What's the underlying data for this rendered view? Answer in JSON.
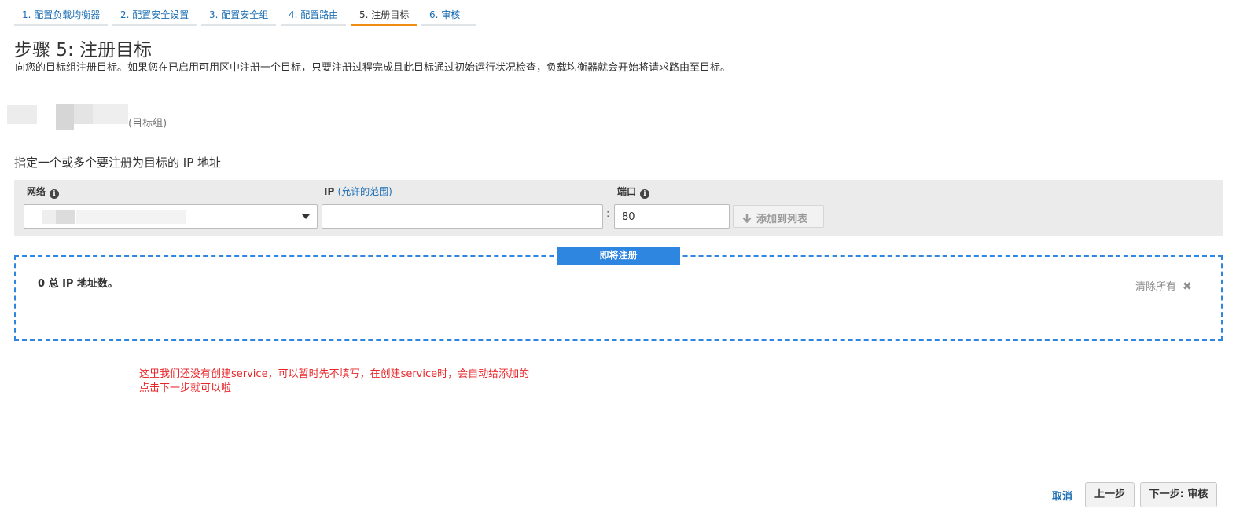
{
  "wizard": {
    "steps": [
      {
        "label": "1. 配置负载均衡器"
      },
      {
        "label": "2. 配置安全设置"
      },
      {
        "label": "3. 配置安全组"
      },
      {
        "label": "4. 配置路由"
      },
      {
        "label": "5. 注册目标",
        "active": true
      },
      {
        "label": "6. 审核"
      }
    ]
  },
  "page": {
    "title": "步骤 5: 注册目标",
    "description": "向您的目标组注册目标。如果您在已启用可用区中注册一个目标，只要注册过程完成且此目标通过初始运行状况检查，负载均衡器就会开始将请求路由至目标。",
    "target_group_suffix": "(目标组)"
  },
  "ip_targets": {
    "heading": "指定一个或多个要注册为目标的 IP 地址",
    "network_label": "网络",
    "ip_label": "IP",
    "ip_range_link": "(允许的范围)",
    "port_label": "端口",
    "port_value": "80",
    "ip_value": "",
    "add_button": "添加到列表",
    "colon": ":"
  },
  "pending": {
    "tag": "即将注册",
    "total": "0 总 IP 地址数。",
    "clear_all": "清除所有"
  },
  "annotation": {
    "line1": "这里我们还没有创建service，可以暂时先不填写，在创建service时，会自动给添加的",
    "line2": "点击下一步就可以啦"
  },
  "footer": {
    "cancel": "取消",
    "previous": "上一步",
    "next": "下一步: 审核"
  },
  "colors": {
    "link": "#1a6db3",
    "active_tab": "#f08c13",
    "dashed_border": "#2f86e0",
    "annotation": "#e8262a"
  },
  "icons": [
    "info-icon",
    "chevron-down-icon",
    "arrow-down-icon",
    "close-icon"
  ]
}
